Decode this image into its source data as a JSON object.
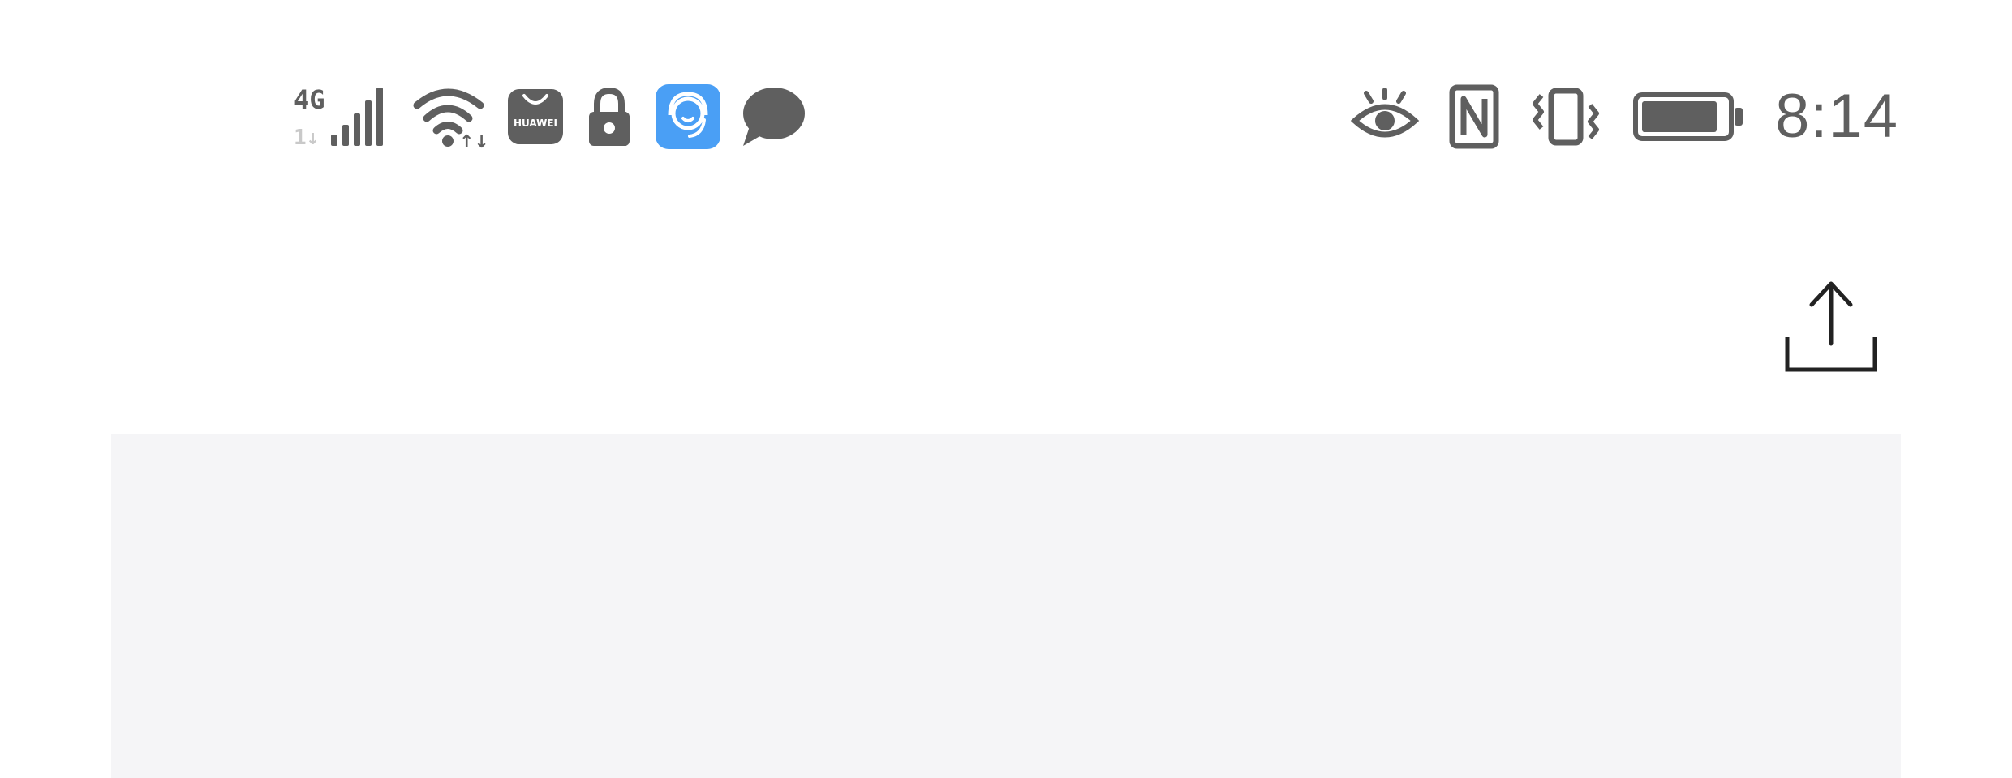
{
  "status_bar": {
    "left_icons": [
      {
        "icon": "mobile-signal-icon",
        "label": "4G"
      },
      {
        "icon": "wifi-icon"
      },
      {
        "icon": "huawei-appgallery-icon",
        "label": "HUAWEI"
      },
      {
        "icon": "lock-icon"
      },
      {
        "icon": "customer-service-icon"
      },
      {
        "icon": "message-bubble-icon"
      }
    ],
    "right_icons": [
      {
        "icon": "eye-comfort-icon"
      },
      {
        "icon": "nfc-icon"
      },
      {
        "icon": "vibrate-icon"
      },
      {
        "icon": "battery-icon",
        "level": 0.9
      }
    ],
    "time": "8:14"
  },
  "action_bar": {
    "share_icon": "share-upload-icon"
  },
  "colors": {
    "status_icon": "#5f5f5f",
    "accent_blue": "#4a9ff5",
    "card_background": "#f5f5f7"
  }
}
